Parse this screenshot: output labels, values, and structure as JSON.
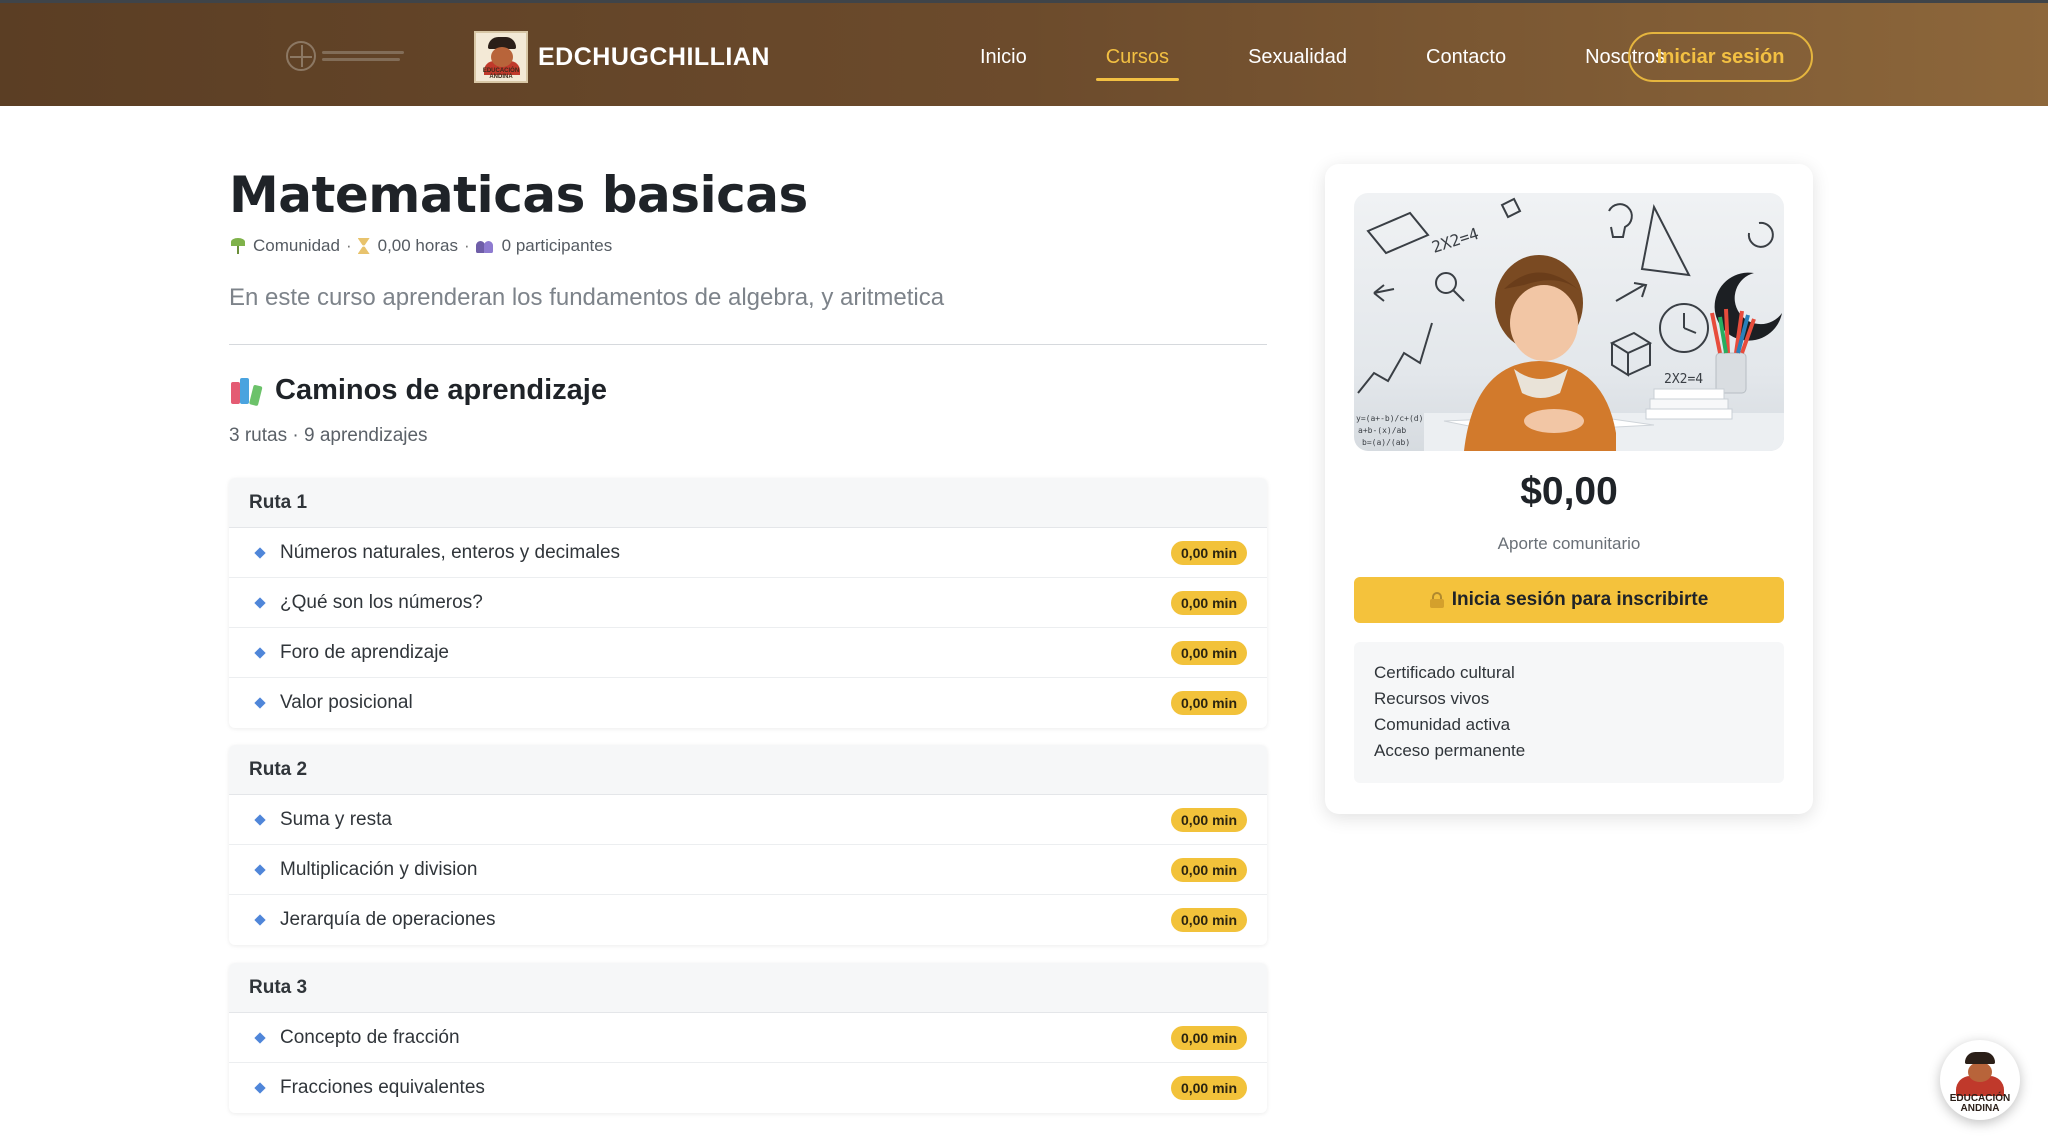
{
  "header": {
    "brand_name": "EDCHUGCHILLIAN",
    "brand_badge_text": "EDUCACIÓN ANDINA",
    "nav": [
      {
        "label": "Inicio",
        "active": false
      },
      {
        "label": "Cursos",
        "active": true
      },
      {
        "label": "Sexualidad",
        "active": false
      },
      {
        "label": "Contacto",
        "active": false
      },
      {
        "label": "Nosotros",
        "active": false
      }
    ],
    "login_label": "Iniciar sesión"
  },
  "course": {
    "title": "Matematicas basicas",
    "meta": {
      "category": "Comunidad",
      "hours": "0,00 horas",
      "participants": "0 participantes"
    },
    "description": "En este curso aprenderan los fundamentos de algebra, y aritmetica"
  },
  "paths": {
    "title": "Caminos de aprendizaje",
    "summary": "3 rutas · 9 aprendizajes",
    "routes": [
      {
        "name": "Ruta 1",
        "lessons": [
          {
            "title": "Números naturales, enteros y decimales",
            "duration": "0,00 min"
          },
          {
            "title": "¿Qué son los números?",
            "duration": "0,00 min"
          },
          {
            "title": "Foro de aprendizaje",
            "duration": "0,00 min"
          },
          {
            "title": "Valor posicional",
            "duration": "0,00 min"
          }
        ]
      },
      {
        "name": "Ruta 2",
        "lessons": [
          {
            "title": "Suma y resta",
            "duration": "0,00 min"
          },
          {
            "title": "Multiplicación y division",
            "duration": "0,00 min"
          },
          {
            "title": "Jerarquía de operaciones",
            "duration": "0,00 min"
          }
        ]
      },
      {
        "name": "Ruta 3",
        "lessons": [
          {
            "title": "Concepto de fracción",
            "duration": "0,00 min"
          },
          {
            "title": "Fracciones equivalentes",
            "duration": "0,00 min"
          }
        ]
      }
    ]
  },
  "sidebar": {
    "price": "$0,00",
    "price_note": "Aporte comunitario",
    "enroll_label": "Inicia sesión para inscribirte",
    "features": [
      "Certificado cultural",
      "Recursos vivos",
      "Comunidad activa",
      "Acceso permanente"
    ]
  },
  "chat": {
    "badge_text": "EDUCACIÓN ANDINA"
  },
  "colors": {
    "header_start": "#5b3e24",
    "header_end": "#8d673b",
    "accent": "#f3c042",
    "pill": "#f2c23a",
    "bullet": "#4f86d9"
  },
  "icons": {
    "category": "sprout-icon",
    "hours": "hourglass-icon",
    "participants": "people-icon",
    "section": "books-icon",
    "enroll": "lock-icon",
    "bullet": "diamond-bullet-icon"
  }
}
